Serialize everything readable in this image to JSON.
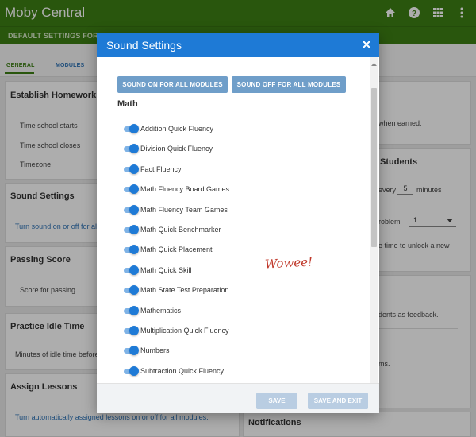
{
  "app": {
    "title": "Moby Central",
    "subheader": "DEFAULT SETTINGS FOR ALL GROUPS",
    "tabs": [
      "GENERAL",
      "MODULES"
    ],
    "icons": [
      "home-icon",
      "help-icon",
      "apps-grid-icon",
      "more-vert-icon"
    ],
    "accent_color": "#3d7f14"
  },
  "background": {
    "left_cards": [
      {
        "title": "Establish Homework Ti",
        "rows": [
          "Time school starts",
          "Time school closes",
          "Timezone"
        ]
      },
      {
        "title": "Sound Settings",
        "link": "Turn sound on or off for all"
      },
      {
        "title": "Passing Score",
        "rows": [
          "Score for passing"
        ]
      },
      {
        "title": "Practice Idle Time",
        "rows": [
          "Minutes of idle time before"
        ]
      },
      {
        "title": "Assign Lessons",
        "link": "Turn automatically assigned lessons on or off for all modules."
      }
    ],
    "right": {
      "earned": "when earned.",
      "students_head": "Students",
      "every_label": "every",
      "every_value": "5",
      "minutes_label": "minutes",
      "problem_label": "roblem",
      "problem_value": "1",
      "unlock_text": "e time to unlock a new",
      "feedback_text": "dents as feedback.",
      "ms_text": "ms.",
      "notifications": "Notifications"
    }
  },
  "modal": {
    "title": "Sound Settings",
    "close_icon": "close-icon",
    "header_color": "#1e7ad6",
    "sound_on_label": "SOUND ON FOR ALL MODULES",
    "sound_off_label": "SOUND OFF FOR ALL MODULES",
    "section_title": "Math",
    "modules": [
      {
        "label": "Addition Quick Fluency",
        "on": true
      },
      {
        "label": "Division Quick Fluency",
        "on": true
      },
      {
        "label": "Fact Fluency",
        "on": true
      },
      {
        "label": "Math Fluency Board Games",
        "on": true
      },
      {
        "label": "Math Fluency Team Games",
        "on": true
      },
      {
        "label": "Math Quick Benchmarker",
        "on": true
      },
      {
        "label": "Math Quick Placement",
        "on": true
      },
      {
        "label": "Math Quick Skill",
        "on": true
      },
      {
        "label": "Math State Test Preparation",
        "on": true
      },
      {
        "label": "Mathematics",
        "on": true
      },
      {
        "label": "Multiplication Quick Fluency",
        "on": true
      },
      {
        "label": "Numbers",
        "on": true
      },
      {
        "label": "Subtraction Quick Fluency",
        "on": true
      }
    ],
    "annotation": "Wowee!",
    "save_label": "SAVE",
    "save_exit_label": "SAVE AND EXIT"
  }
}
